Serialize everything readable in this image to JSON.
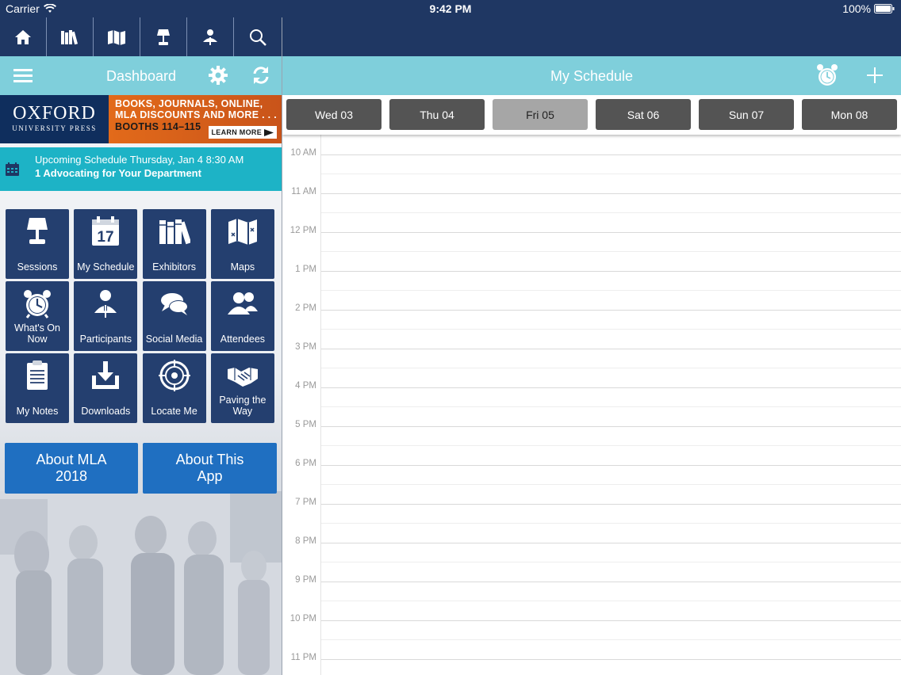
{
  "status_bar": {
    "carrier": "Carrier",
    "time": "9:42 PM",
    "battery": "100%"
  },
  "nav_icons": [
    "home-icon",
    "books-icon",
    "map-icon",
    "lamp-icon",
    "speaker-icon",
    "search-icon"
  ],
  "dashboard": {
    "title": "Dashboard"
  },
  "banner": {
    "brand_line1": "OXFORD",
    "brand_line2": "UNIVERSITY PRESS",
    "promo_line1": "BOOKS, JOURNALS, ONLINE,",
    "promo_line2": "MLA DISCOUNTS AND MORE . . .",
    "promo_line3": "BOOTHS 114–115",
    "learn_more": "LEARN MORE"
  },
  "upcoming": {
    "line1": "Upcoming Schedule Thursday, Jan 4 8:30 AM",
    "line2": "1 Advocating for Your Department"
  },
  "tiles": [
    {
      "label": "Sessions",
      "icon": "lamp-icon"
    },
    {
      "label": "My Schedule",
      "icon": "calendar-icon"
    },
    {
      "label": "Exhibitors",
      "icon": "books-icon"
    },
    {
      "label": "Maps",
      "icon": "map-icon"
    },
    {
      "label": "What's On Now",
      "icon": "alarm-clock-icon"
    },
    {
      "label": "Participants",
      "icon": "speaker-icon"
    },
    {
      "label": "Social Media",
      "icon": "chat-bubbles-icon"
    },
    {
      "label": "Attendees",
      "icon": "people-icon"
    },
    {
      "label": "My Notes",
      "icon": "clipboard-icon"
    },
    {
      "label": "Downloads",
      "icon": "download-icon"
    },
    {
      "label": "Locate Me",
      "icon": "target-icon"
    },
    {
      "label": "Paving the Way",
      "icon": "handshake-icon"
    }
  ],
  "about_buttons": [
    "About MLA 2018",
    "About This App"
  ],
  "schedule": {
    "title": "My Schedule",
    "days": [
      {
        "label": "Wed 03",
        "selected": false
      },
      {
        "label": "Thu 04",
        "selected": false
      },
      {
        "label": "Fri 05",
        "selected": true
      },
      {
        "label": "Sat 06",
        "selected": false
      },
      {
        "label": "Sun 07",
        "selected": false
      },
      {
        "label": "Mon 08",
        "selected": false
      }
    ],
    "hours": [
      "10 AM",
      "11 AM",
      "12 PM",
      "1 PM",
      "2 PM",
      "3 PM",
      "4 PM",
      "5 PM",
      "6 PM",
      "7 PM",
      "8 PM",
      "9 PM",
      "10 PM",
      "11 PM"
    ]
  },
  "colors": {
    "navy": "#1f3763",
    "teal_bar": "#7fcfdb",
    "upcoming_teal": "#1db3c6",
    "tile_blue": "#243f6f",
    "about_blue": "#1f6fc1",
    "day_button": "#545454",
    "day_selected": "#a6a6a6"
  }
}
